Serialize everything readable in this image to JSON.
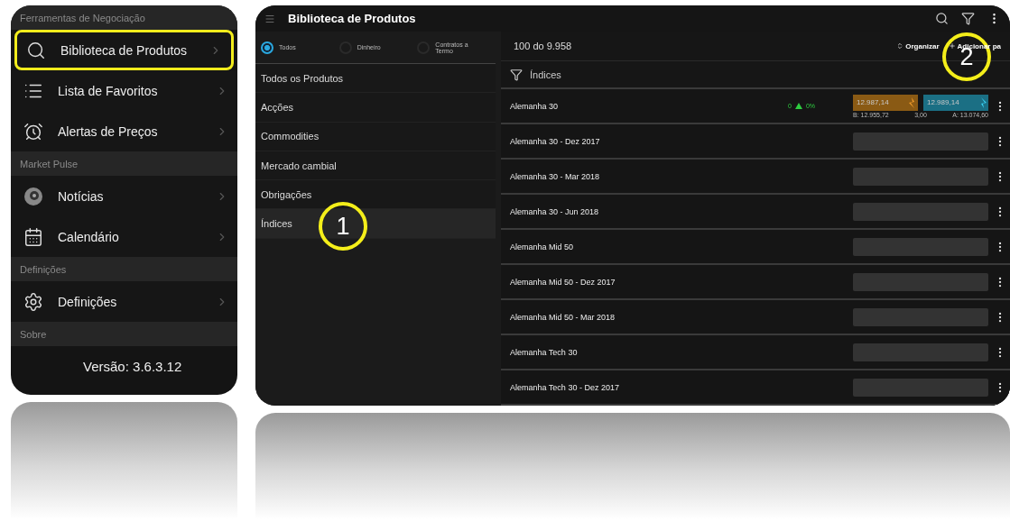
{
  "menu": {
    "sections": [
      {
        "title": "Ferramentas de Negociação",
        "items": [
          {
            "label": "Biblioteca de Produtos",
            "highlighted": true
          },
          {
            "label": "Lista de Favoritos",
            "highlighted": false
          },
          {
            "label": "Alertas de Preços",
            "highlighted": false
          }
        ]
      },
      {
        "title": "Market Pulse",
        "items": [
          {
            "label": "Notícias",
            "highlighted": false
          },
          {
            "label": "Calendário",
            "highlighted": false
          }
        ]
      },
      {
        "title": "Definições",
        "items": [
          {
            "label": "Definições",
            "highlighted": false
          }
        ]
      },
      {
        "title": "Sobre",
        "version": "Versão: 3.6.3.12"
      }
    ]
  },
  "library": {
    "title": "Biblioteca de Produtos",
    "filters": [
      {
        "label": "Todos",
        "selected": true
      },
      {
        "label": "Dinheiro",
        "selected": false
      },
      {
        "label": "Contratos a Termo",
        "selected": false
      }
    ],
    "categories": [
      {
        "label": "Todos os Produtos",
        "selected": false
      },
      {
        "label": "Acções",
        "selected": false
      },
      {
        "label": "Commodities",
        "selected": false
      },
      {
        "label": "Mercado cambial",
        "selected": false
      },
      {
        "label": "Obrigações",
        "selected": false
      },
      {
        "label": "Índices",
        "selected": true
      }
    ],
    "count": "100 do 9.958",
    "sort": "Organizar",
    "add": "Adicionar pa",
    "filter_label": "Índices",
    "rows": [
      {
        "name": "Alemanha 30",
        "change": "0",
        "change_pct": "0%",
        "sell": "12.987,14",
        "buy": "12.989,14",
        "low": "B: 12.955,72",
        "spread": "3,00",
        "high": "A: 13.074,60"
      },
      {
        "name": "Alemanha 30 - Dez 2017"
      },
      {
        "name": "Alemanha 30 - Mar 2018"
      },
      {
        "name": "Alemanha 30 - Jun 2018"
      },
      {
        "name": "Alemanha Mid 50"
      },
      {
        "name": "Alemanha Mid 50 - Dez 2017"
      },
      {
        "name": "Alemanha Mid 50 - Mar 2018"
      },
      {
        "name": "Alemanha Tech 30"
      },
      {
        "name": "Alemanha Tech 30 - Dez 2017"
      }
    ]
  },
  "callouts": [
    {
      "label": "1"
    },
    {
      "label": "2"
    }
  ]
}
